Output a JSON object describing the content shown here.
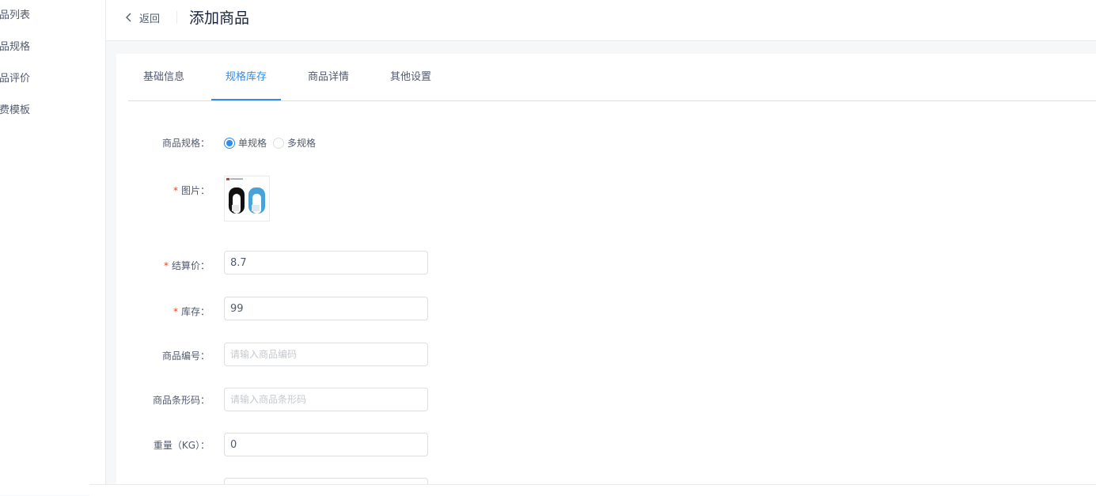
{
  "sidebar": {
    "items": [
      {
        "label": "商品列表"
      },
      {
        "label": "商品规格"
      },
      {
        "label": "商品评价"
      },
      {
        "label": "运费模板"
      }
    ]
  },
  "header": {
    "back_label": "返回",
    "title": "添加商品"
  },
  "tabs": [
    {
      "label": "基础信息",
      "active": false
    },
    {
      "label": "规格库存",
      "active": true
    },
    {
      "label": "商品详情",
      "active": false
    },
    {
      "label": "其他设置",
      "active": false
    }
  ],
  "form": {
    "spec_type": {
      "label": "商品规格：",
      "options": [
        {
          "label": "单规格",
          "checked": true
        },
        {
          "label": "多规格",
          "checked": false
        }
      ]
    },
    "image": {
      "label": "图片：",
      "required": true
    },
    "settle_price": {
      "label": "结算价：",
      "required": true,
      "value": "8.7"
    },
    "stock": {
      "label": "库存：",
      "required": true,
      "value": "99"
    },
    "product_code": {
      "label": "商品编号：",
      "placeholder": "请输入商品编码",
      "value": ""
    },
    "barcode": {
      "label": "商品条形码：",
      "placeholder": "请输入商品条形码",
      "value": ""
    },
    "weight": {
      "label": "重量（KG）：",
      "value": "0"
    }
  },
  "colors": {
    "primary": "#2d8cf0",
    "required": "#ed4014",
    "text": "#515a6e",
    "title": "#17233d"
  },
  "icons": {
    "back": "chevron-left-icon"
  }
}
